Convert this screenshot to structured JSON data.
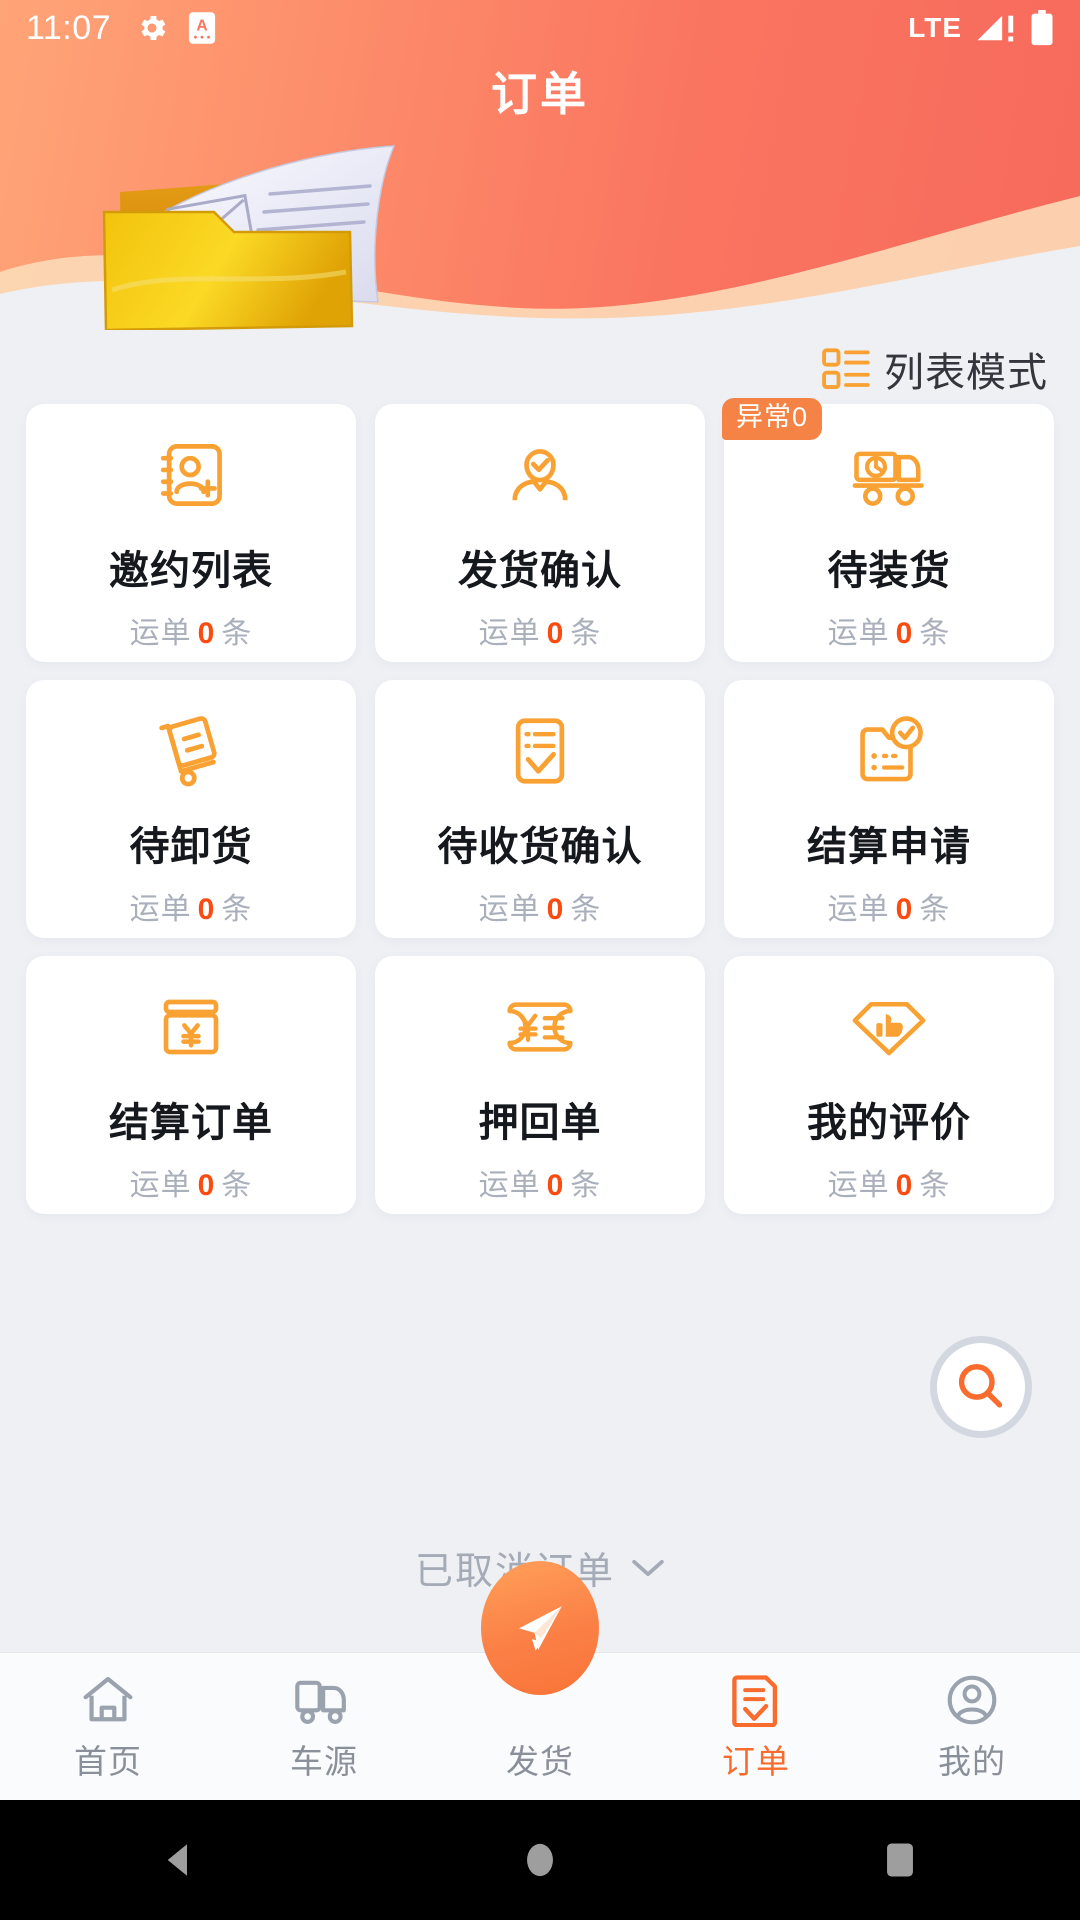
{
  "status_bar": {
    "time": "11:07",
    "network": "LTE",
    "icons": [
      "gear-icon",
      "app-badge-icon",
      "signal-icon",
      "battery-icon"
    ]
  },
  "header": {
    "title": "订单",
    "illustration": "folder-document-illustration"
  },
  "list_mode": {
    "label": "列表模式",
    "icon": "list-mode-icon"
  },
  "grid": {
    "cards": [
      {
        "title": "邀约列表",
        "sub_prefix": "运单",
        "count": "0",
        "sub_suffix": "条",
        "icon": "contact-book-add-icon",
        "badge": null
      },
      {
        "title": "发货确认",
        "sub_prefix": "运单",
        "count": "0",
        "sub_suffix": "条",
        "icon": "person-check-icon",
        "badge": null
      },
      {
        "title": "待装货",
        "sub_prefix": "运单",
        "count": "0",
        "sub_suffix": "条",
        "icon": "truck-clock-icon",
        "badge": "异常0"
      },
      {
        "title": "待卸货",
        "sub_prefix": "运单",
        "count": "0",
        "sub_suffix": "条",
        "icon": "hand-truck-icon",
        "badge": null
      },
      {
        "title": "待收货确认",
        "sub_prefix": "运单",
        "count": "0",
        "sub_suffix": "条",
        "icon": "checklist-icon",
        "badge": null
      },
      {
        "title": "结算申请",
        "sub_prefix": "运单",
        "count": "0",
        "sub_suffix": "条",
        "icon": "invoice-check-icon",
        "badge": null
      },
      {
        "title": "结算订单",
        "sub_prefix": "运单",
        "count": "0",
        "sub_suffix": "条",
        "icon": "yuan-card-icon",
        "badge": null
      },
      {
        "title": "押回单",
        "sub_prefix": "运单",
        "count": "0",
        "sub_suffix": "条",
        "icon": "yuan-ticket-icon",
        "badge": null
      },
      {
        "title": "我的评价",
        "sub_prefix": "运单",
        "count": "0",
        "sub_suffix": "条",
        "icon": "diamond-thumbsup-icon",
        "badge": null
      }
    ]
  },
  "search_fab": {
    "icon": "search-icon"
  },
  "cancelled_orders": {
    "label": "已取消订单",
    "icon": "chevron-down-icon"
  },
  "tabbar": {
    "items": [
      {
        "label": "首页",
        "icon": "home-icon",
        "active": false
      },
      {
        "label": "车源",
        "icon": "truck-icon",
        "active": false
      },
      {
        "label": "发货",
        "icon": "send-icon",
        "active": false
      },
      {
        "label": "订单",
        "icon": "order-doc-icon",
        "active": true
      },
      {
        "label": "我的",
        "icon": "user-icon",
        "active": false
      }
    ]
  },
  "android_nav": {
    "back": "back-triangle-icon",
    "home": "home-circle-icon",
    "recents": "recents-square-icon"
  },
  "colors": {
    "brand_orange": "#fa6b2e",
    "icon_orange": "#f9a132",
    "count_red": "#fa4b10",
    "badge_orange": "#f58345",
    "page_bg": "#eef0f4",
    "card_bg": "#ffffff",
    "title_dark": "#15181d",
    "muted_gray": "#a9afbb"
  }
}
